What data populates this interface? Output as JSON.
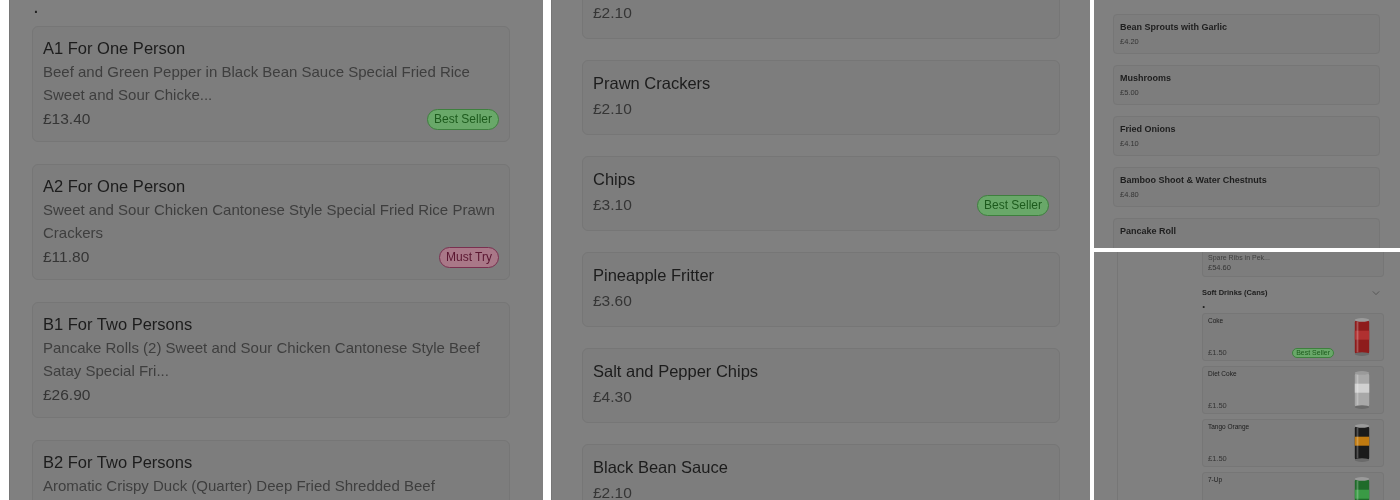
{
  "panels": [
    {
      "kind": "menu",
      "marker": ".",
      "items": [
        {
          "title": "A1 For One Person",
          "description": "Beef and Green Pepper in Black Bean Sauce Special Fried Rice Sweet and Sour Chicke...",
          "price": "£13.40",
          "badge": {
            "label": "Best Seller",
            "kind": "best-seller"
          }
        },
        {
          "title": "A2 For One Person",
          "description": "Sweet and Sour Chicken Cantonese Style Special Fried Rice Prawn Crackers",
          "price": "£11.80",
          "badge": {
            "label": "Must Try",
            "kind": "must-try"
          }
        },
        {
          "title": "B1 For Two Persons",
          "description": "Pancake Rolls (2) Sweet and Sour Chicken Cantonese Style Beef Satay Special Fri...",
          "price": "£26.90"
        },
        {
          "title": "B2 For Two Persons",
          "description": "Aromatic Crispy Duck (Quarter) Deep Fried Shredded Beef"
        }
      ]
    },
    {
      "kind": "menu",
      "items": [
        {
          "price": "£2.10"
        },
        {
          "title": "Prawn Crackers",
          "price": "£2.10"
        },
        {
          "title": "Chips",
          "price": "£3.10",
          "badge": {
            "label": "Best Seller",
            "kind": "best-seller"
          }
        },
        {
          "title": "Pineapple Fritter",
          "price": "£3.60"
        },
        {
          "title": "Salt and Pepper Chips",
          "price": "£4.30"
        },
        {
          "title": "Black Bean Sauce",
          "price": "£2.10"
        }
      ]
    },
    {
      "kind": "compact",
      "items": [
        {
          "title": "Bean Sprouts with Garlic",
          "price": "£4.20"
        },
        {
          "title": "Mushrooms",
          "price": "£5.00"
        },
        {
          "title": "Fried Onions",
          "price": "£4.10"
        },
        {
          "title": "Bamboo Shoot & Water Chestnuts",
          "price": "£4.80"
        },
        {
          "title": "Pancake Roll"
        }
      ]
    },
    {
      "kind": "drinks",
      "partial_item": {
        "description": "Spare Ribs in Pek...",
        "price": "£54.60"
      },
      "section": {
        "title": "Soft Drinks (Cans)",
        "expanded": true,
        "marker": "."
      },
      "items": [
        {
          "title": "Coke",
          "price": "£1.50",
          "badge": {
            "label": "Best Seller",
            "kind": "best-seller"
          }
        },
        {
          "title": "Diet Coke",
          "price": "£1.50"
        },
        {
          "title": "Tango Orange",
          "price": "£1.50"
        },
        {
          "title": "7-Up"
        }
      ]
    }
  ]
}
